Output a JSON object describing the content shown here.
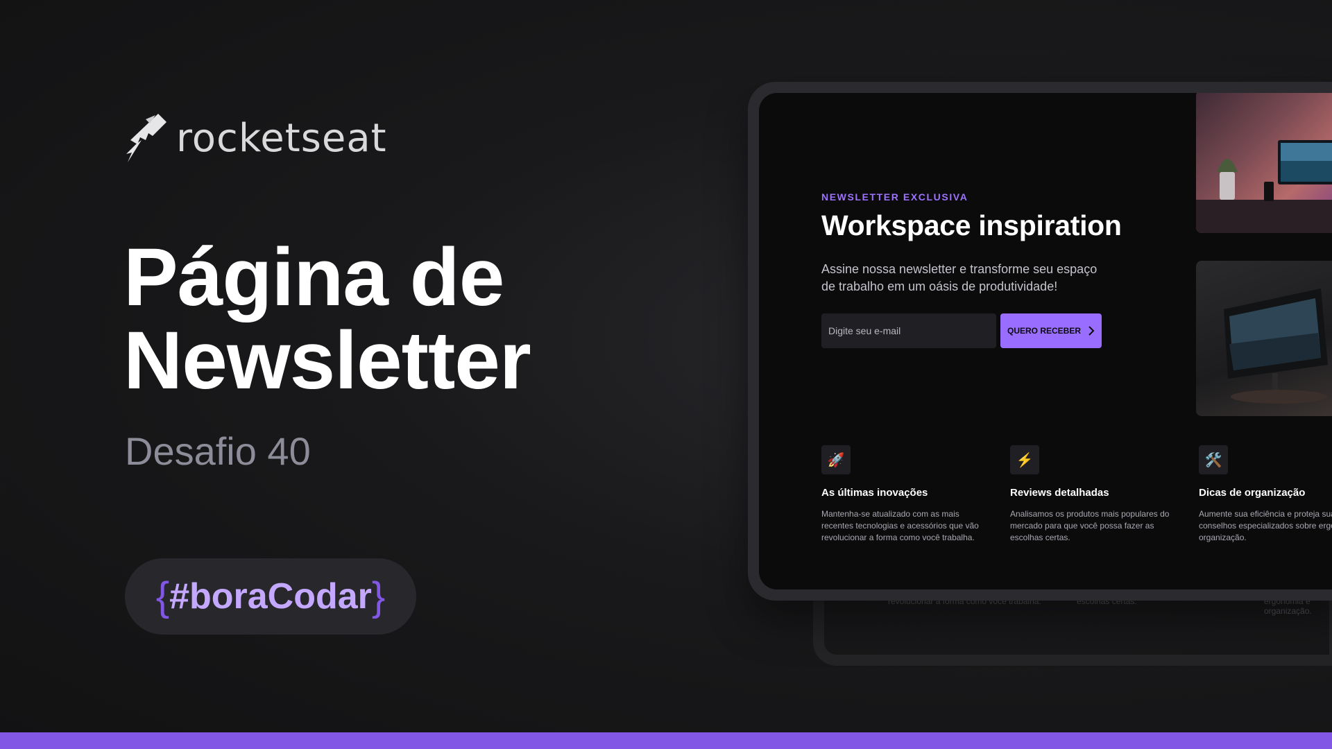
{
  "brand": {
    "name": "rocketseat",
    "icon": "rocket-icon"
  },
  "hero": {
    "title_line1": "Página de",
    "title_line2": "Newsletter",
    "subtitle": "Desafio 40",
    "tag_open": "{",
    "tag_text": "#boraCodar",
    "tag_close": "}"
  },
  "newsletter": {
    "eyebrow": "NEWSLETTER EXCLUSIVA",
    "title": "Workspace inspiration",
    "description": "Assine nossa newsletter e transforme seu espaço de trabalho em um oásis de produtividade!",
    "email_placeholder": "Digite seu e-mail",
    "submit_label": "QUERO RECEBER",
    "features": [
      {
        "icon": "🚀",
        "title": "As últimas inovações",
        "text": "Mantenha-se atualizado com as mais recentes tecnologias e acessórios que vão revolucionar a forma como você trabalha."
      },
      {
        "icon": "⚡",
        "title": "Reviews detalhadas",
        "text": "Analisamos os produtos mais populares do mercado para que você possa fazer as escolhas certas."
      },
      {
        "icon": "🛠️",
        "title": "Dicas de organização",
        "text": "Aumente sua eficiência e proteja sua com conselhos especializados sobre ergonomia e organização."
      }
    ]
  },
  "back_frame": {
    "text1": "revolucionar a forma como você trabalha.",
    "text2": "escolhas certas.",
    "text3": "ergonomia e organização."
  },
  "colors": {
    "accent": "#8257e5",
    "button": "#996dff",
    "eyebrow": "#9d72ff"
  }
}
